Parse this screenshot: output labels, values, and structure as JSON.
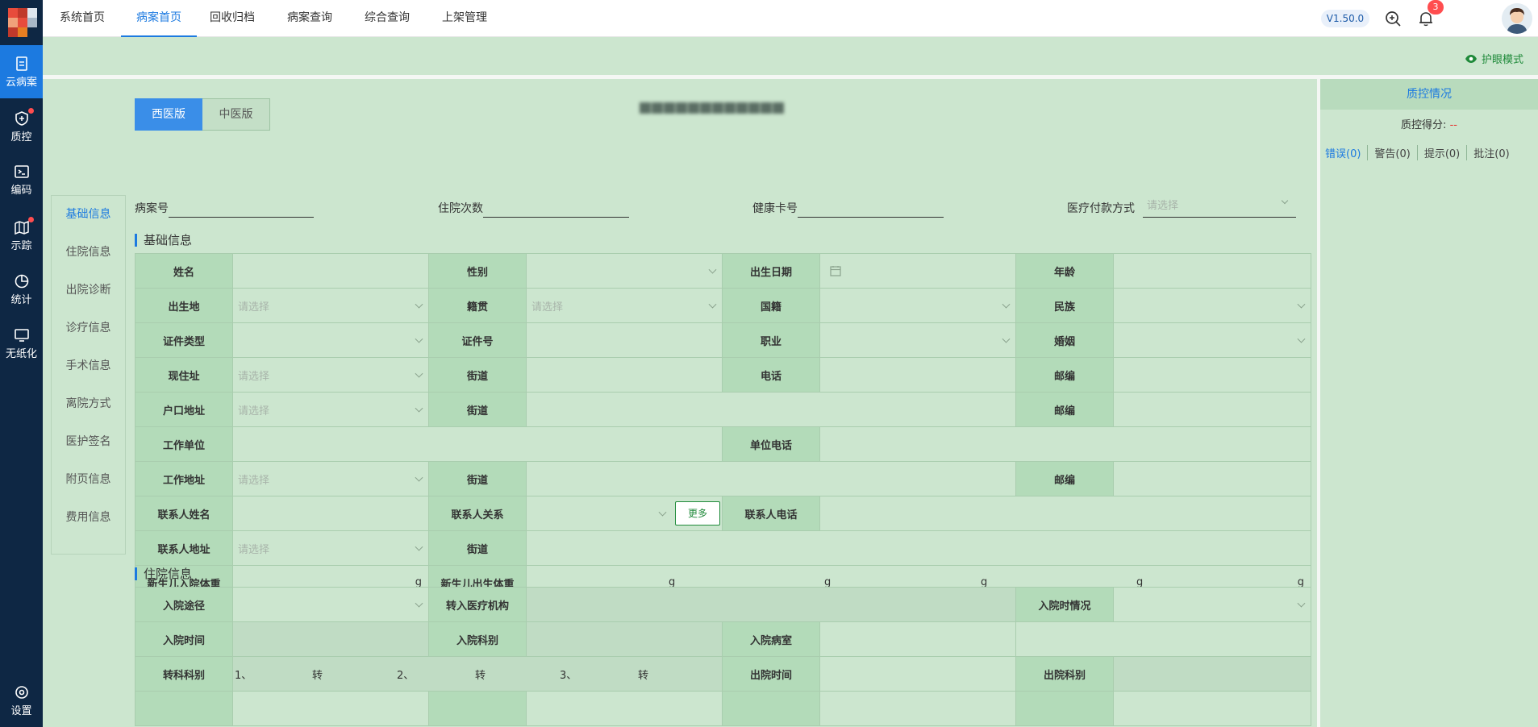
{
  "sidebar": {
    "items": [
      {
        "label": "云病案",
        "icon": "document-icon",
        "active": true,
        "dot": false
      },
      {
        "label": "质控",
        "icon": "shield-plus-icon",
        "active": false,
        "dot": true
      },
      {
        "label": "编码",
        "icon": "terminal-icon",
        "active": false,
        "dot": false
      },
      {
        "label": "示踪",
        "icon": "map-icon",
        "active": false,
        "dot": true
      },
      {
        "label": "统计",
        "icon": "pie-chart-icon",
        "active": false,
        "dot": false
      },
      {
        "label": "无纸化",
        "icon": "monitor-icon",
        "active": false,
        "dot": false
      },
      {
        "label": "设置",
        "icon": "settings-icon",
        "active": false,
        "dot": false
      }
    ]
  },
  "topnav": {
    "tabs": [
      "系统首页",
      "病案首页",
      "回收归档",
      "病案查询",
      "综合查询",
      "上架管理"
    ],
    "active_tab": "病案首页",
    "version": "V1.50.0",
    "notification_count": "3"
  },
  "eye_mode": "护眼模式",
  "version_toggle": {
    "western": "西医版",
    "chinese": "中医版"
  },
  "side_tabs": [
    "基础信息",
    "住院信息",
    "出院诊断",
    "诊疗信息",
    "手术信息",
    "离院方式",
    "医护签名",
    "附页信息",
    "费用信息"
  ],
  "meta": {
    "case_no_label": "病案号",
    "admission_count_label": "住院次数",
    "health_card_label": "健康卡号",
    "payment_label": "医疗付款方式",
    "payment_placeholder": "请选择"
  },
  "basic": {
    "title": "基础信息",
    "placeholder": "请选择",
    "more_button": "更多",
    "unit_g": "g",
    "labels": {
      "name": "姓名",
      "gender": "性别",
      "birth_date": "出生日期",
      "age": "年龄",
      "birthplace": "出生地",
      "native_place": "籍贯",
      "nationality": "国籍",
      "ethnicity": "民族",
      "id_type": "证件类型",
      "id_no": "证件号",
      "occupation": "职业",
      "marriage": "婚姻",
      "current_address": "现住址",
      "street": "街道",
      "phone": "电话",
      "postcode": "邮编",
      "household_address": "户口地址",
      "work_unit": "工作单位",
      "work_phone": "单位电话",
      "work_address": "工作地址",
      "contact_name": "联系人姓名",
      "contact_relation": "联系人关系",
      "contact_phone": "联系人电话",
      "contact_address": "联系人地址",
      "newborn_admit_weight": "新生儿入院体重",
      "newborn_birth_weight": "新生儿出生体重"
    }
  },
  "hospital": {
    "title": "住院信息",
    "labels": {
      "admit_route": "入院途径",
      "transfer_in": "转入医疗机构",
      "admit_condition": "入院时情况",
      "admit_time": "入院时间",
      "admit_dept": "入院科别",
      "admit_ward": "入院病室",
      "transfer_dept": "转科科别",
      "discharge_time": "出院时间",
      "discharge_dept": "出院科别"
    },
    "transfer_items": [
      "1、",
      "转",
      "2、",
      "转",
      "3、",
      "转"
    ]
  },
  "quality": {
    "title": "质控情况",
    "score_label": "质控得分:",
    "score_value": "--",
    "tabs": [
      "错误(0)",
      "警告(0)",
      "提示(0)",
      "批注(0)"
    ]
  }
}
